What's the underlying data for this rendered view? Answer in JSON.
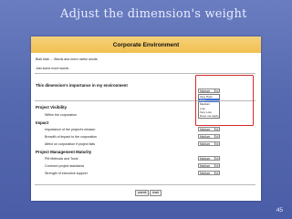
{
  "slide": {
    "title": "Adjust the dimension's weight",
    "number": "45"
  },
  "header": {
    "title": "Corporate Environment"
  },
  "intro": {
    "line1": "Blah blah ... Words and more useful words",
    "line2": "Just some more words"
  },
  "importance": {
    "heading": "This dimension's importance in my environment",
    "selected": "Medium",
    "options": [
      "Very High",
      "High",
      "Medium",
      "Low",
      "Very Low",
      "Does not apply"
    ],
    "highlighted_index": 1
  },
  "sections": [
    {
      "title": "Project Visibility",
      "rows": [
        {
          "label": "Within the corporation"
        }
      ]
    },
    {
      "title": "Impact",
      "rows": [
        {
          "label": "Importance of the project's mission",
          "value": "Medium"
        },
        {
          "label": "Breadth of impact to the corporation",
          "value": "Medium"
        },
        {
          "label": "Affect on corporation if project fails",
          "value": "Medium"
        }
      ]
    },
    {
      "title": "Project Management Maturity",
      "rows": [
        {
          "label": "PM Methods and Tools",
          "value": "Medium"
        },
        {
          "label": "Common project standards",
          "value": "Medium"
        },
        {
          "label": "Strength of executive support",
          "value": "Medium"
        }
      ]
    }
  ],
  "buttons": {
    "submit": "submit",
    "reset": "reset"
  },
  "colors": {
    "slide_bg": "#5569b0",
    "banner": "#f0c050",
    "highlight_box": "#d42a2a"
  }
}
